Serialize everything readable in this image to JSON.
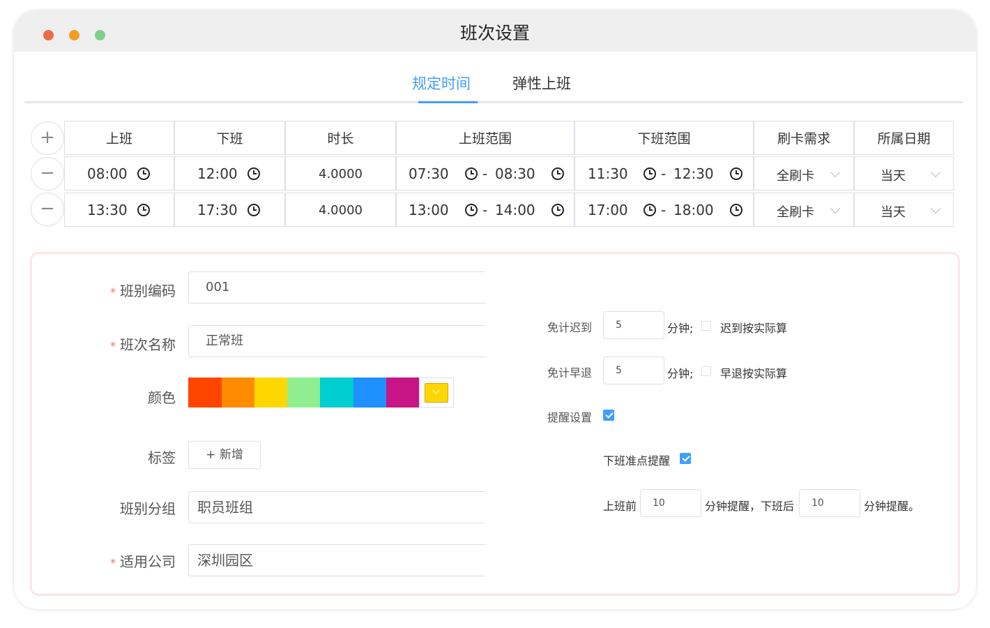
{
  "window": {
    "title": "班次设置",
    "dot_colors": [
      "#ed6a44",
      "#f0a020",
      "#7fcf8a"
    ]
  },
  "tabs": [
    {
      "label": "规定时间",
      "active": true
    },
    {
      "label": "弹性上班",
      "active": false
    }
  ],
  "table": {
    "add_button": "+",
    "remove_button": "−",
    "headers": [
      "上班",
      "下班",
      "时长",
      "上班范围",
      "下班范围",
      "刷卡需求",
      "所属日期"
    ],
    "rows": [
      {
        "start": "08:00",
        "end": "12:00",
        "duration": "4.0000",
        "start_range_from": "07:30",
        "start_range_to": "08:30",
        "range_sep": "-",
        "end_range_from": "11:30",
        "end_range_to": "12:30",
        "card": "全刷卡",
        "date": "当天"
      },
      {
        "start": "13:30",
        "end": "17:30",
        "duration": "4.0000",
        "start_range_from": "13:00",
        "start_range_to": "14:00",
        "range_sep": "-",
        "end_range_from": "17:00",
        "end_range_to": "18:00",
        "card": "全刷卡",
        "date": "当天"
      }
    ]
  },
  "form": {
    "required_mark": "*",
    "code_label": "班别编码",
    "code_value": "001",
    "name_label": "班次名称",
    "name_value": "正常班",
    "color_label": "颜色",
    "colors": [
      "#ff4500",
      "#ff8c00",
      "#ffd700",
      "#90ee90",
      "#00ced1",
      "#1e90ff",
      "#c71585"
    ],
    "selected_color": "#ffd700",
    "tag_label": "标签",
    "tag_add": "+ 新增",
    "group_label": "班别分组",
    "group_value": "职员班组",
    "company_label": "适用公司",
    "company_value": "深圳园区"
  },
  "settings": {
    "late_label": "免计迟到",
    "late_value": "5",
    "minute_unit": "分钟;",
    "late_actual": "迟到按实际算",
    "late_actual_checked": false,
    "early_label": "免计早退",
    "early_value": "5",
    "early_actual": "早退按实际算",
    "early_actual_checked": false,
    "remind_label": "提醒设置",
    "remind_checked": true,
    "offwork_remind": "下班准点提醒",
    "offwork_remind_checked": true,
    "before_label": "上班前",
    "before_value": "10",
    "mid_text": "分钟提醒，下班后",
    "after_value": "10",
    "end_text": "分钟提醒。"
  }
}
